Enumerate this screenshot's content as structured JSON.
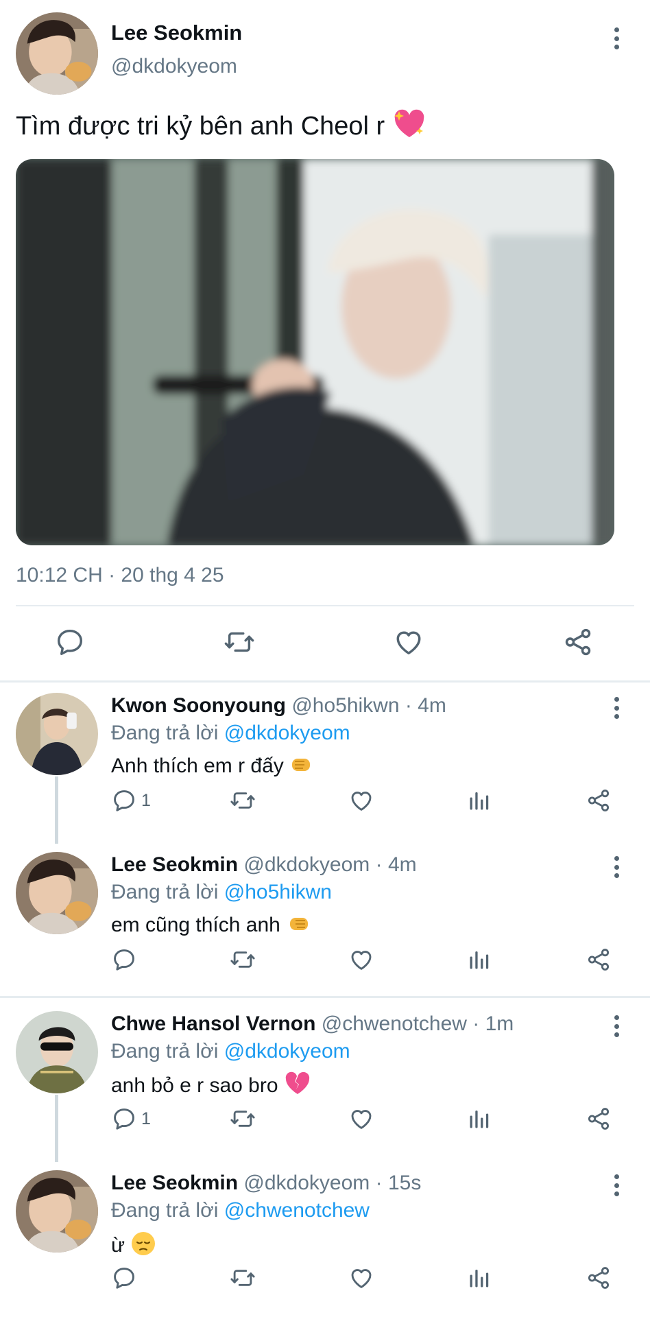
{
  "colors": {
    "link": "#1d9bf0",
    "muted": "#657786",
    "icon": "#536471",
    "divider": "#e6ecf0"
  },
  "main_tweet": {
    "author_name": "Lee Seokmin",
    "handle": "@dkdokyeom",
    "text": "Tìm được tri kỷ bên anh Cheol r",
    "text_emoji": "sparkling-heart",
    "timestamp": "10:12 CH · 20 thg 4 25",
    "actions": [
      "reply-icon",
      "retweet-icon",
      "like-icon",
      "share-icon"
    ]
  },
  "replies": [
    {
      "name": "Kwon Soonyoung",
      "handle_time": "@ho5hikwn · 4m",
      "replying_prefix": "Đang trả lời",
      "replying_to": "@dkdokyeom",
      "text": "Anh thích em r đấy",
      "emoji": "left-fist",
      "reply_count": "1"
    },
    {
      "name": "Lee Seokmin",
      "handle_time": "@dkdokyeom · 4m",
      "replying_prefix": "Đang trả lời",
      "replying_to": "@ho5hikwn",
      "text": "em cũng thích anh",
      "emoji": "right-fist",
      "reply_count": ""
    },
    {
      "name": "Chwe Hansol Vernon",
      "handle_time": "@chwenotchew · 1m",
      "replying_prefix": "Đang trả lời",
      "replying_to": "@dkdokyeom",
      "text": "anh bỏ e r sao bro",
      "emoji": "broken-heart",
      "reply_count": "1"
    },
    {
      "name": "Lee Seokmin",
      "handle_time": "@dkdokyeom · 15s",
      "replying_prefix": "Đang trả lời",
      "replying_to": "@chwenotchew",
      "text": "ừ",
      "emoji": "pensive-face",
      "reply_count": ""
    }
  ]
}
